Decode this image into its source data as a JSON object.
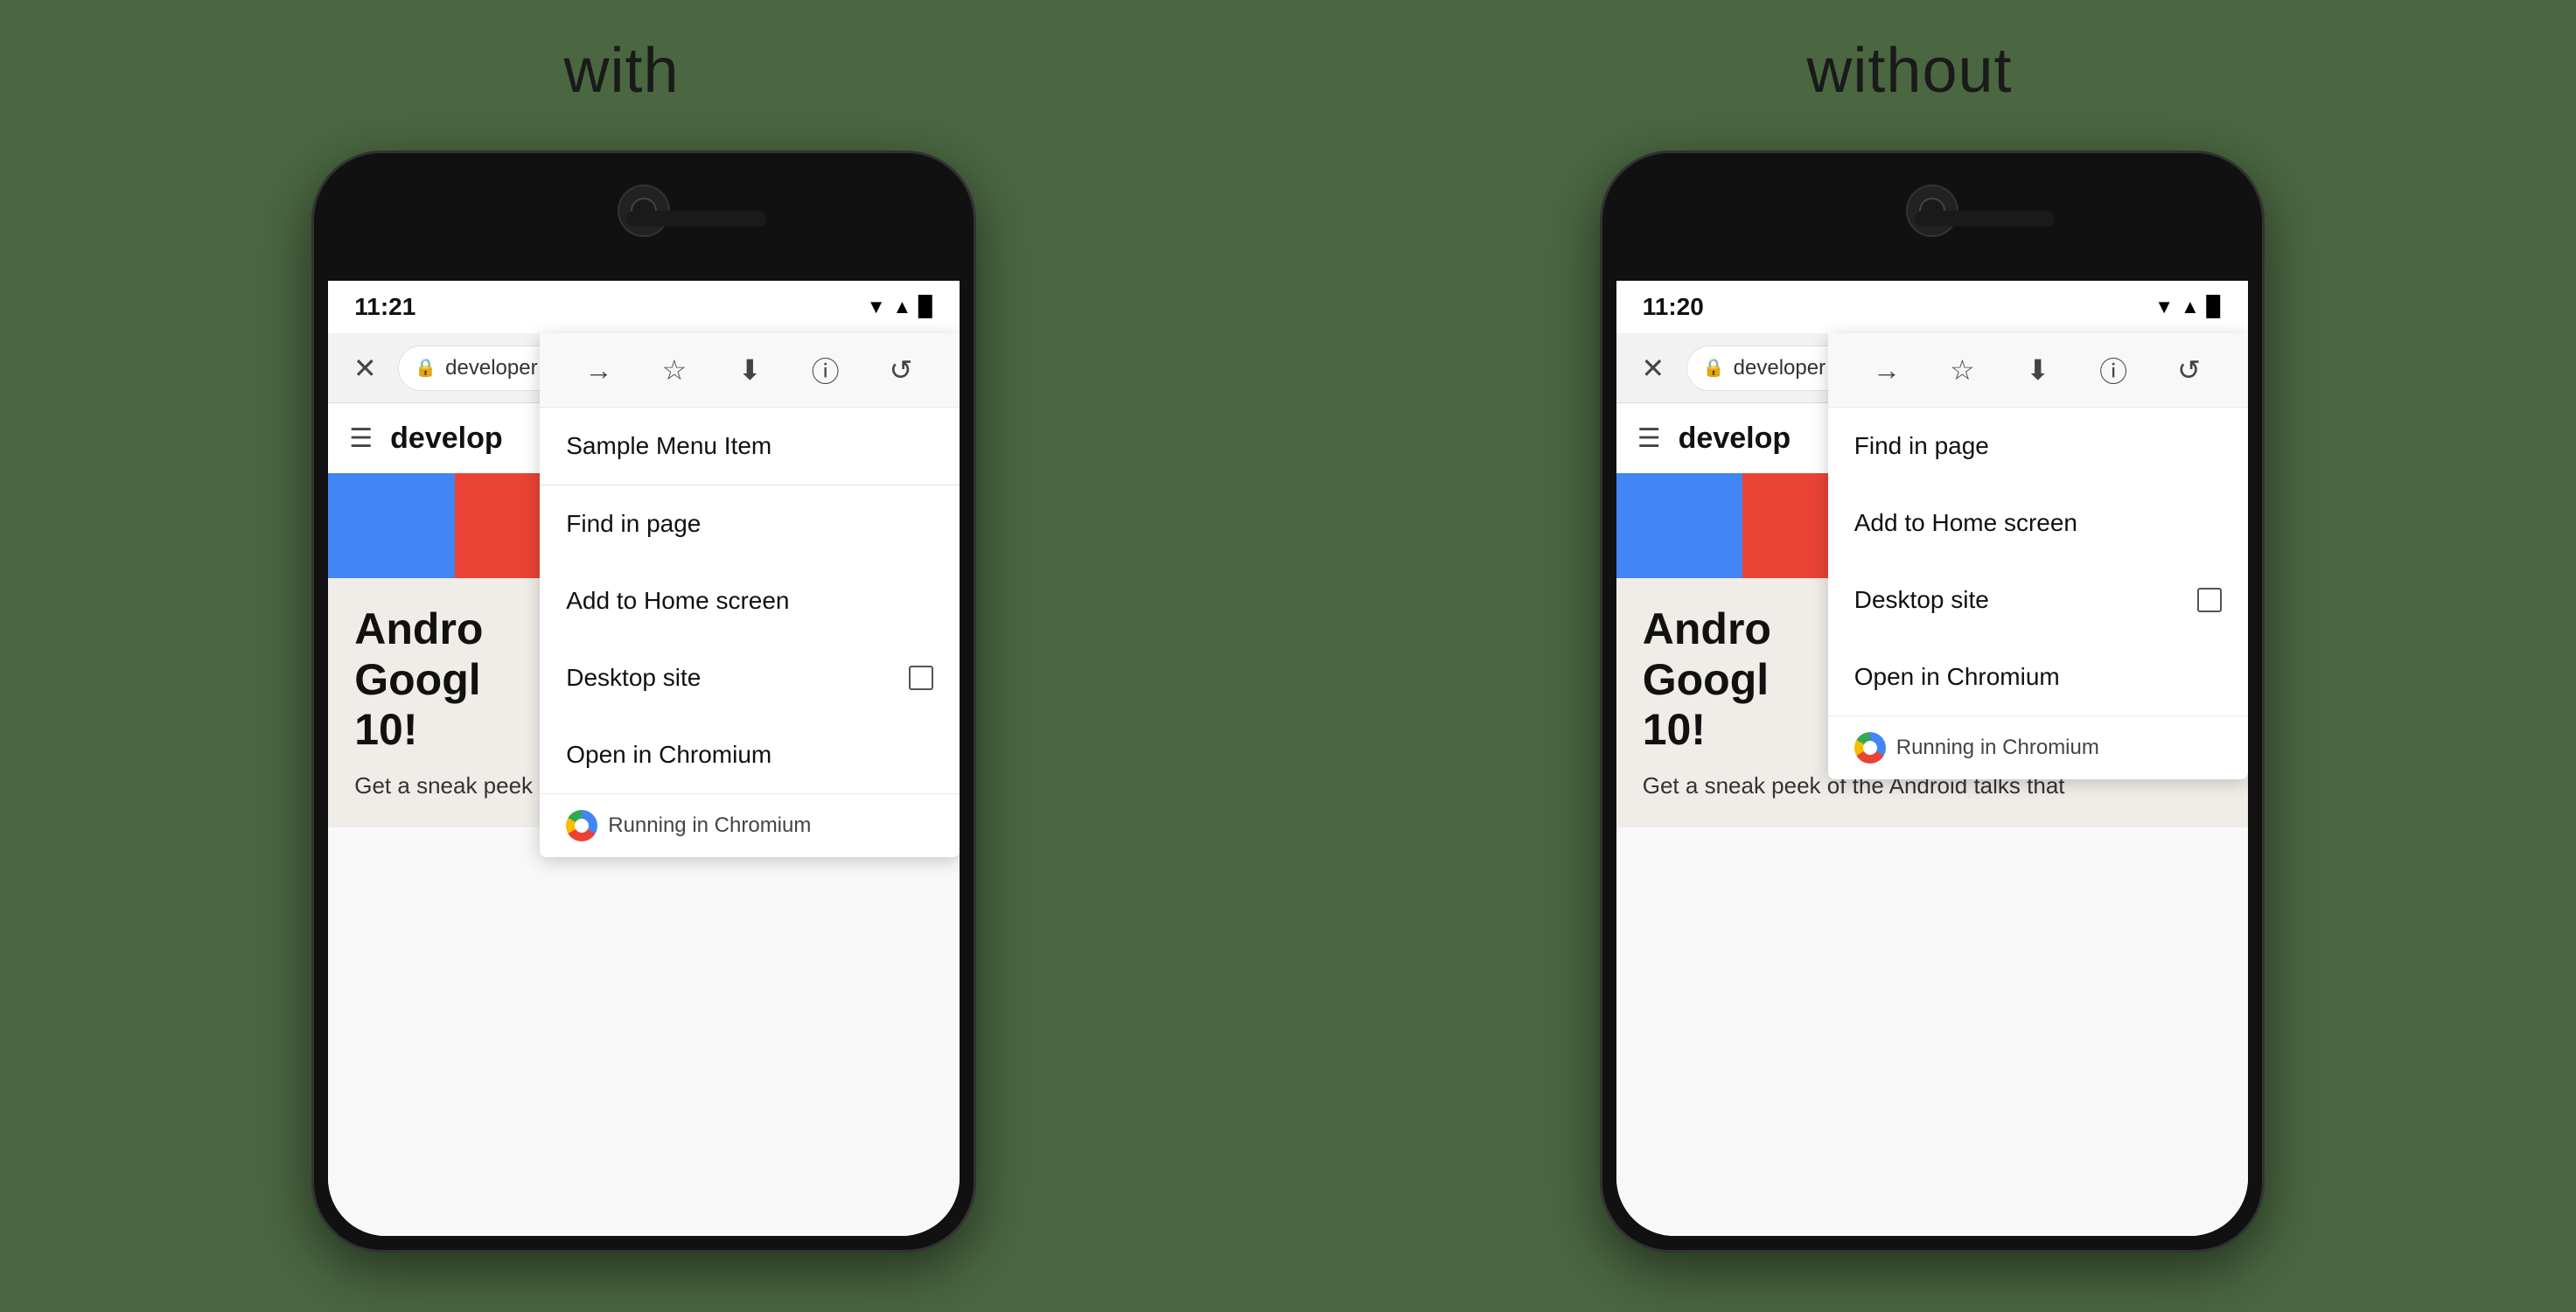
{
  "background_color": "#4a6741",
  "labels": {
    "with": "with",
    "without": "without"
  },
  "phone_left": {
    "status": {
      "time": "11:21",
      "icons": "▼▲▉"
    },
    "address_bar": {
      "text": "developer",
      "lock": "🔒"
    },
    "menu": {
      "icons": [
        "→",
        "☆",
        "⬇",
        "ⓘ",
        "↺"
      ],
      "sample_item": "Sample Menu Item",
      "items": [
        {
          "label": "Find in page",
          "has_checkbox": false
        },
        {
          "label": "Add to Home screen",
          "has_checkbox": false
        },
        {
          "label": "Desktop site",
          "has_checkbox": true
        },
        {
          "label": "Open in Chromium",
          "has_checkbox": false
        }
      ],
      "running_badge": "Running in Chromium"
    },
    "page": {
      "app_bar_title": "develop",
      "color_bars": [
        "#4285f4",
        "#ea4335",
        "#34a853",
        "#fbbc04",
        "#111111"
      ],
      "hero_title": "Andro\nGoogl\n10!",
      "hero_subtitle": "Get a sneak peek of the Android talks that"
    }
  },
  "phone_right": {
    "status": {
      "time": "11:20",
      "icons": "▼▲▉"
    },
    "address_bar": {
      "text": "developer",
      "lock": "🔒"
    },
    "menu": {
      "icons": [
        "→",
        "☆",
        "⬇",
        "ⓘ",
        "↺"
      ],
      "items": [
        {
          "label": "Find in page",
          "has_checkbox": false
        },
        {
          "label": "Add to Home screen",
          "has_checkbox": false
        },
        {
          "label": "Desktop site",
          "has_checkbox": true
        },
        {
          "label": "Open in Chromium",
          "has_checkbox": false
        }
      ],
      "running_badge": "Running in Chromium"
    },
    "page": {
      "app_bar_title": "develop",
      "color_bars": [
        "#4285f4",
        "#ea4335",
        "#34a853",
        "#fbbc04",
        "#111111"
      ],
      "hero_title": "Andro\nGoogl\n10!",
      "hero_subtitle": "Get a sneak peek of the Android talks that"
    }
  }
}
